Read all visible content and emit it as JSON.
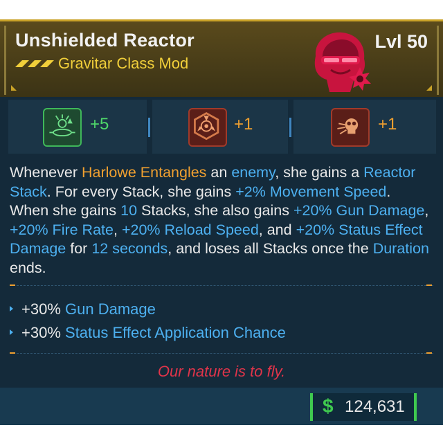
{
  "item": {
    "name": "Unshielded Reactor",
    "level": "Lvl 50",
    "type": "Gravitar Class Mod",
    "rarity_color": "#f1cf3a",
    "portrait_icon": "harlowe-portrait-icon"
  },
  "skills": [
    {
      "icon": "skill-tree-green-icon",
      "value": "+5",
      "color": "#4fd86a"
    },
    {
      "icon": "radiation-emblem-icon",
      "value": "+1",
      "color": "#f0a030"
    },
    {
      "icon": "skull-burst-icon",
      "value": "+1",
      "color": "#f0a030"
    }
  ],
  "description": {
    "p1": "Whenever ",
    "harlowe": "Harlowe Entangles",
    "p2": " an ",
    "enemy": "enemy",
    "p3": ", she gains a ",
    "reactor_stack": "Reactor Stack",
    "p4": ". For every Stack, she gains ",
    "ms_value": "+2%",
    "p5": " ",
    "ms_name": "Movement Speed",
    "p6": ". When she gains ",
    "stacks": "10",
    "p7": " Stacks, she also gains ",
    "gun_dmg": "+20% Gun Damage",
    "p8": ", ",
    "fire_rate": "+20% Fire Rate",
    "p9": ", ",
    "reload": "+20% Reload Speed",
    "p10": ", and ",
    "status_dmg": "+20% Status Effect Damage",
    "p11": " for ",
    "seconds": "12 seconds",
    "p12": ", and loses all Stacks once the ",
    "duration": "Duration",
    "p13": " ends."
  },
  "bonuses": [
    {
      "value": "+30%",
      "stat": "Gun Damage"
    },
    {
      "value": "+30%",
      "stat": "Status Effect Application Chance"
    }
  ],
  "flavor_text": "Our nature is to fly.",
  "price": {
    "symbol": "$",
    "value": "124,631",
    "color": "#3fc94f"
  }
}
